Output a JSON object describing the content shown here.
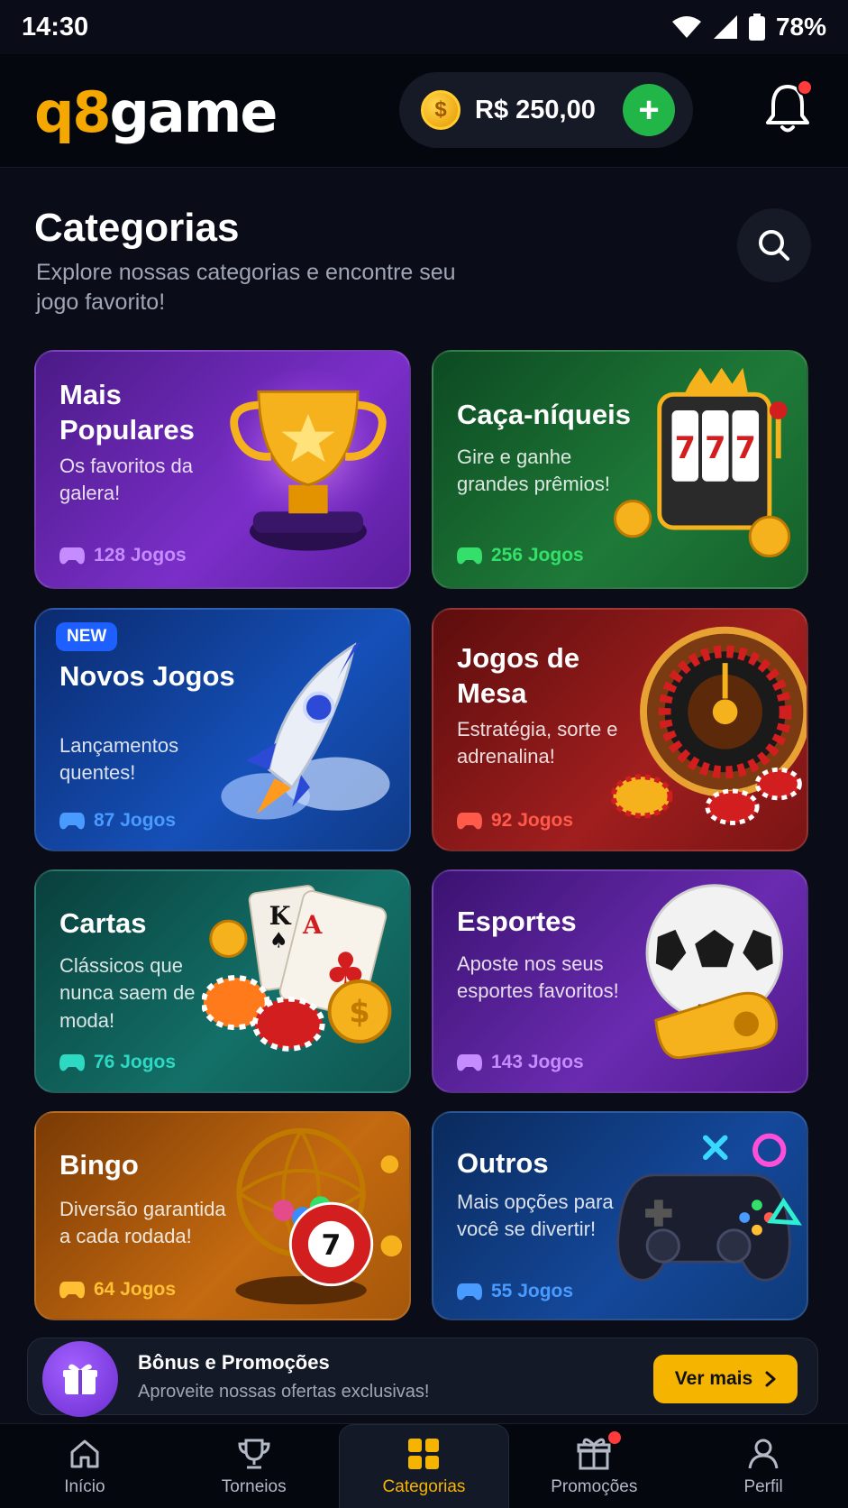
{
  "status": {
    "time": "14:30",
    "battery": "78%"
  },
  "header": {
    "logo_part1": "q8",
    "logo_part2": "game",
    "balance": "R$ 250,00",
    "coin_symbol": "$",
    "add_symbol": "+"
  },
  "page": {
    "title": "Categorias",
    "subtitle": "Explore nossas categorias e encontre seu jogo favorito!"
  },
  "categories": [
    {
      "title": "Mais Populares",
      "desc": "Os favoritos da galera!",
      "count": "128 Jogos",
      "accent": "#c58cff",
      "bg": "#5a1d9c"
    },
    {
      "title": "Caça-níqueis",
      "desc": "Gire e ganhe grandes prêmios!",
      "count": "256 Jogos",
      "accent": "#35e06a",
      "bg": "#16692f"
    },
    {
      "title": "Novos Jogos",
      "desc": "Lançamentos quentes!",
      "count": "87 Jogos",
      "accent": "#4a9bff",
      "bg": "#103a86",
      "badge": "NEW"
    },
    {
      "title": "Jogos de Mesa",
      "desc": "Estratégia, sorte e adrenalina!",
      "count": "92 Jogos",
      "accent": "#ff5a4a",
      "bg": "#7a1414"
    },
    {
      "title": "Cartas",
      "desc": "Clássicos que nunca saem de moda!",
      "count": "76 Jogos",
      "accent": "#2ed9c4",
      "bg": "#0f5550"
    },
    {
      "title": "Esportes",
      "desc": "Aposte nos seus esportes favoritos!",
      "count": "143 Jogos",
      "accent": "#c58cff",
      "bg": "#4e1a8a"
    },
    {
      "title": "Bingo",
      "desc": "Diversão garantida a cada rodada!",
      "count": "64 Jogos",
      "accent": "#ffc133",
      "bg": "#a5570a"
    },
    {
      "title": "Outros",
      "desc": "Mais opções para você se divertir!",
      "count": "55 Jogos",
      "accent": "#4a9bff",
      "bg": "#0e3a78"
    }
  ],
  "promo": {
    "title": "Bônus e Promoções",
    "subtitle": "Aproveite nossas ofertas exclusivas!",
    "button": "Ver mais"
  },
  "nav": [
    {
      "label": "Início",
      "icon": "home-icon"
    },
    {
      "label": "Torneios",
      "icon": "trophy-icon"
    },
    {
      "label": "Categorias",
      "icon": "grid-icon",
      "active": true
    },
    {
      "label": "Promoções",
      "icon": "gift-icon"
    },
    {
      "label": "Perfil",
      "icon": "user-icon"
    }
  ]
}
